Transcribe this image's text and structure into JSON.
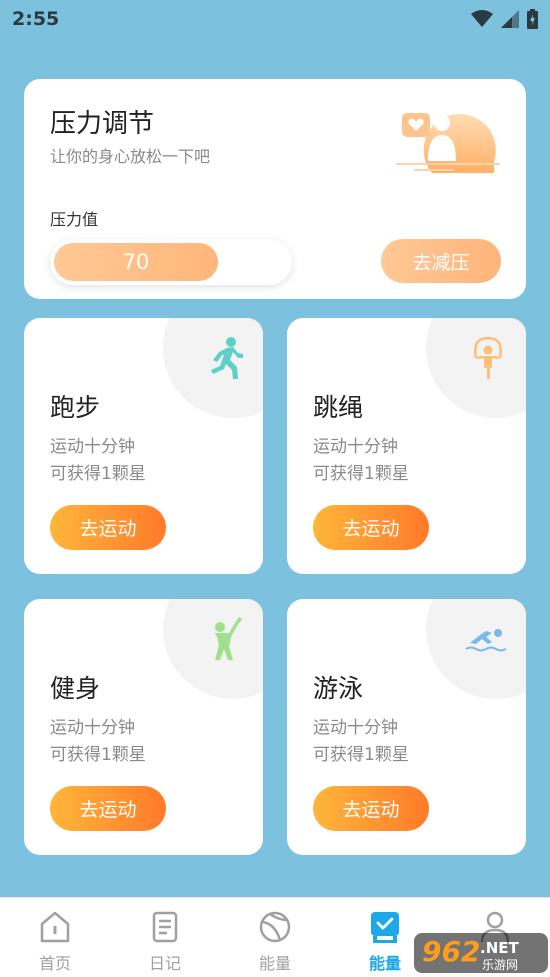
{
  "status_bar": {
    "time": "2:55"
  },
  "stress": {
    "title": "压力调节",
    "subtitle": "让你的身心放松一下吧",
    "label": "压力值",
    "value": "70",
    "level_percent": 70,
    "button": "去减压"
  },
  "exercises": [
    {
      "name": "跑步",
      "desc1": "运动十分钟",
      "desc2": "可获得1颗星",
      "button": "去运动",
      "icon": "running-icon"
    },
    {
      "name": "跳绳",
      "desc1": "运动十分钟",
      "desc2": "可获得1颗星",
      "button": "去运动",
      "icon": "jump-rope-icon"
    },
    {
      "name": "健身",
      "desc1": "运动十分钟",
      "desc2": "可获得1颗星",
      "button": "去运动",
      "icon": "fitness-icon"
    },
    {
      "name": "游泳",
      "desc1": "运动十分钟",
      "desc2": "可获得1颗星",
      "button": "去运动",
      "icon": "swimming-icon"
    }
  ],
  "nav": {
    "items": [
      {
        "label": "首页",
        "icon": "home-icon"
      },
      {
        "label": "日记",
        "icon": "diary-icon"
      },
      {
        "label": "能量",
        "icon": "ball-icon"
      },
      {
        "label": "能量",
        "icon": "energy-icon",
        "active": true
      },
      {
        "label": "",
        "icon": "profile-icon"
      }
    ]
  },
  "watermark": {
    "text": "962.NET",
    "subtext": "乐游网"
  },
  "colors": {
    "background": "#7cc1dd",
    "accent_orange": "#ff8a2a",
    "stress_orange": "#ffb67a",
    "nav_active": "#1da8e8"
  }
}
